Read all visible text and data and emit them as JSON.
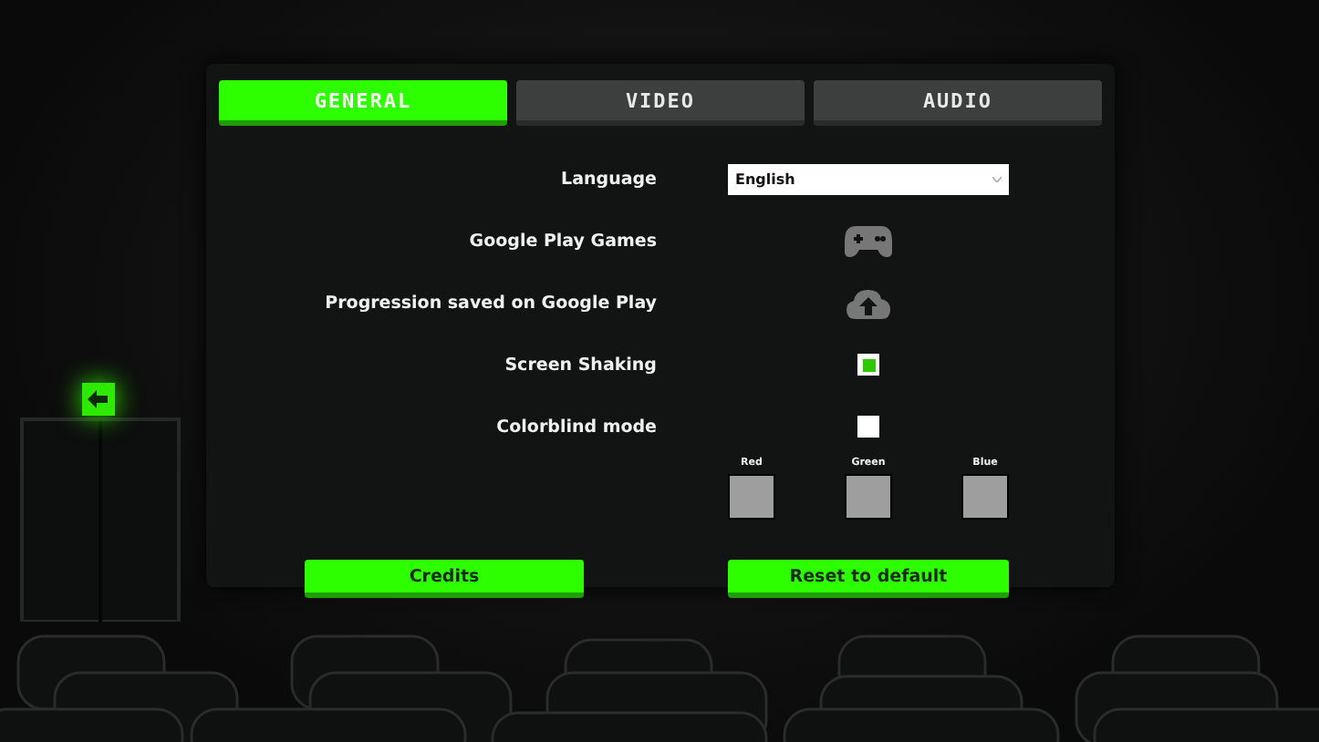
{
  "tabs": [
    {
      "label": "GENERAL",
      "selected": true
    },
    {
      "label": "VIDEO",
      "selected": false
    },
    {
      "label": "AUDIO",
      "selected": false
    }
  ],
  "settings": [
    {
      "kind": "dropdown",
      "label": "Language",
      "value": "English"
    },
    {
      "kind": "connect",
      "label": "Google Play Games"
    },
    {
      "kind": "sync",
      "label": "Progression saved on Google Play"
    },
    {
      "kind": "checkbox",
      "label": "Screen Shaking",
      "checked": true
    },
    {
      "kind": "checkbox",
      "label": "Colorblind mode",
      "checked": false
    }
  ],
  "color_channels": [
    {
      "label": "Red"
    },
    {
      "label": "Green"
    },
    {
      "label": "Blue"
    }
  ],
  "buttons": [
    {
      "label": "Credits"
    },
    {
      "label": "Reset to default"
    }
  ]
}
